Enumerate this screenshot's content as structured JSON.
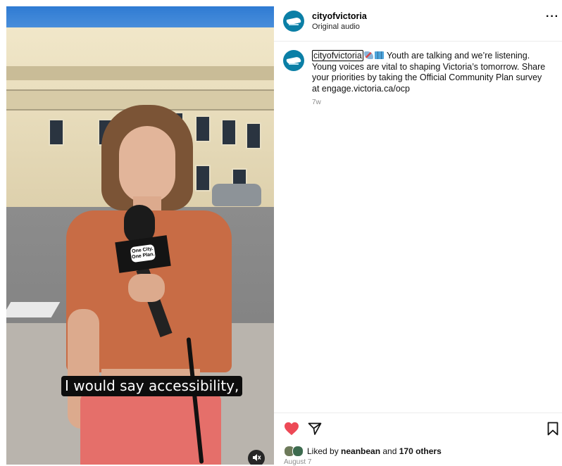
{
  "video": {
    "caption": "I would say accessibility,",
    "mic_flag_text": "One City. One Plan.",
    "mute_icon": "speaker-muted-icon"
  },
  "header": {
    "username": "cityofvictoria",
    "audio": "Original audio",
    "more": "···"
  },
  "post": {
    "username": "cityofvictoria",
    "emoji_1": "rocket",
    "emoji_2": "map",
    "text": "Youth are talking and we’re listening. Young voices are vital to shaping Victoria’s tomorrow. Share your priorities by taking the Official Community Plan survey at engage.victoria.ca/ocp",
    "age": "7w"
  },
  "actions": {
    "like_icon": "heart-filled-icon",
    "share_icon": "send-icon",
    "save_icon": "bookmark-icon",
    "like_color": "#ed4956"
  },
  "likes": {
    "prefix": "Liked by ",
    "user": "neanbean",
    "middle": " and ",
    "others": "170 others"
  },
  "date": "August 7",
  "colors": {
    "brand": "#0b7fa6",
    "caption_bg": "#0d0d0d"
  }
}
